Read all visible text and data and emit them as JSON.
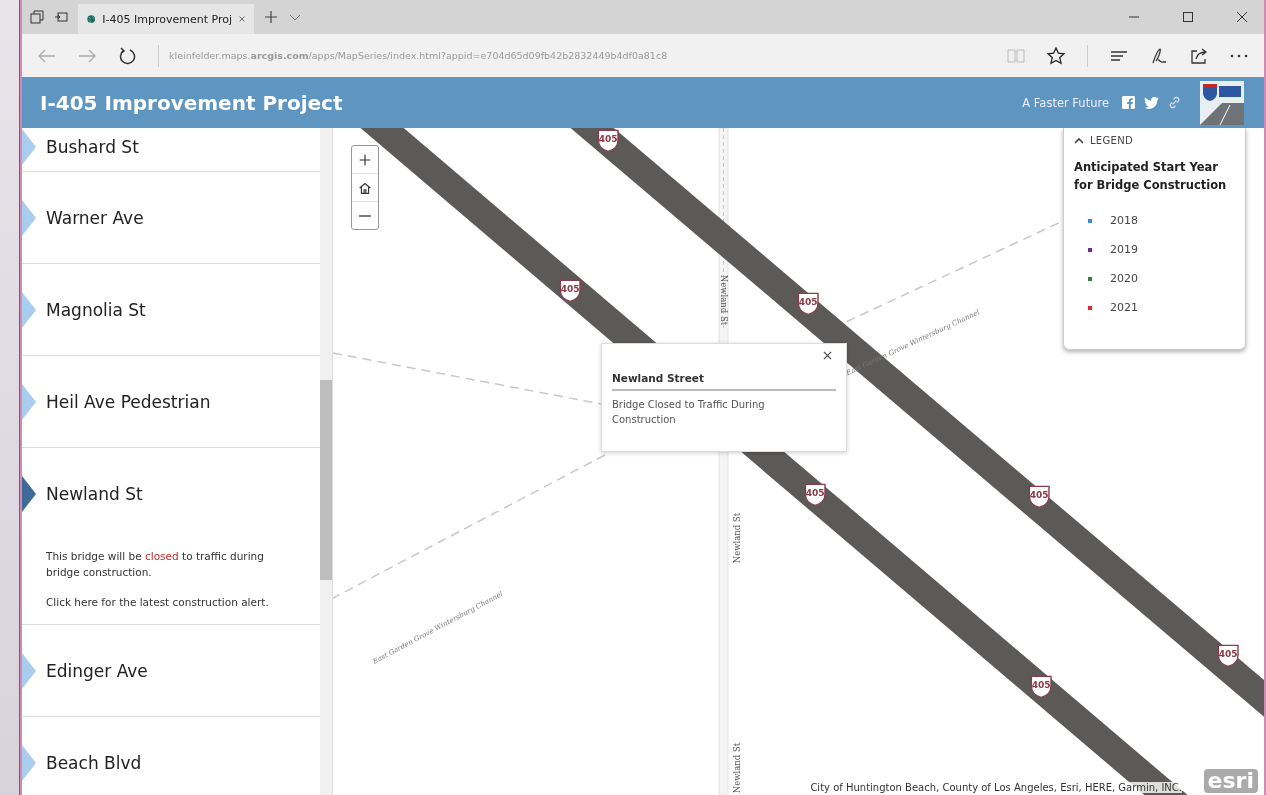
{
  "browser": {
    "tabs": [
      {
        "title": "I-405 Improvement Proj",
        "selected": true
      }
    ],
    "address": "kleinfelder.maps.**arcgis.com**/apps/MapSeries/index.html?appid=e704d65d09fb42b2832449b4df0a81c8"
  },
  "header": {
    "title": "I-405 Improvement Project",
    "tagline": "A Faster Future"
  },
  "sidebar": {
    "items": [
      {
        "label": "Bushard St",
        "selected": false
      },
      {
        "label": "Warner Ave",
        "selected": false
      },
      {
        "label": "Magnolia St",
        "selected": false
      },
      {
        "label": "Heil Ave Pedestrian",
        "selected": false
      },
      {
        "label": "Newland St",
        "selected": true,
        "description": "This bridge will be **closed** to traffic during bridge construction.",
        "link": "Click here for the latest construction alert."
      },
      {
        "label": "Edinger Ave",
        "selected": false
      },
      {
        "label": "Beach Blvd",
        "selected": false
      }
    ]
  },
  "map": {
    "labels": [
      {
        "text": "Newland St",
        "kind": "street"
      },
      {
        "text": "Newland St",
        "kind": "street"
      },
      {
        "text": "Newland St",
        "kind": "street"
      },
      {
        "text": "East Garden Grove Wintersburg Channel",
        "kind": "channel"
      },
      {
        "text": "East Garden Grove Wintersburg Channel",
        "kind": "channel"
      }
    ],
    "shields": [
      "405",
      "405",
      "405",
      "405",
      "405",
      "405",
      "405"
    ],
    "popup": {
      "title": "Newland Street",
      "body": "Bridge Closed to Traffic During Construction"
    },
    "legend": {
      "heading": "LEGEND",
      "title": "Anticipated Start Year for Bridge Construction",
      "items": [
        {
          "label": "2018",
          "color": "#2f8fd8"
        },
        {
          "label": "2019",
          "color": "#6b2d90"
        },
        {
          "label": "2020",
          "color": "#3d7a3d"
        },
        {
          "label": "2021",
          "color": "#e02828"
        }
      ]
    },
    "attribution": "City of Huntington Beach, County of Los Angeles, Esri, HERE, Garmin, INC.",
    "logo": "esri"
  }
}
